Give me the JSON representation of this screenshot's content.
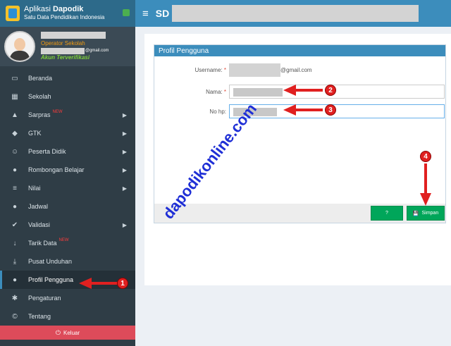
{
  "app": {
    "title_prefix": "Aplikasi",
    "title_bold": "Dapodik",
    "subtitle": "Satu Data Pendidikan Indonesia",
    "school_prefix": "SD"
  },
  "user": {
    "role": "Operator Sekolah",
    "email_suffix": "@gmail.com",
    "status": "Akun Terverifikasi"
  },
  "sidebar": {
    "items": [
      {
        "label": "Beranda",
        "icon": "monitor-icon",
        "glyph": "▭",
        "caret": ""
      },
      {
        "label": "Sekolah",
        "icon": "building-icon",
        "glyph": "▦",
        "caret": ""
      },
      {
        "label": "Sarpras",
        "icon": "road-icon",
        "glyph": "▲",
        "new": "NEW",
        "caret": "▶"
      },
      {
        "label": "GTK",
        "icon": "graduation-cap-icon",
        "glyph": "◆",
        "caret": "▶"
      },
      {
        "label": "Peserta Didik",
        "icon": "smile-icon",
        "glyph": "☺",
        "caret": "▶"
      },
      {
        "label": "Rombongan Belajar",
        "icon": "users-icon",
        "glyph": "●",
        "caret": "▶"
      },
      {
        "label": "Nilai",
        "icon": "list-icon",
        "glyph": "≡",
        "caret": "▶"
      },
      {
        "label": "Jadwal",
        "icon": "group-icon",
        "glyph": "●",
        "caret": ""
      },
      {
        "label": "Validasi",
        "icon": "check-icon",
        "glyph": "✔",
        "caret": "▶"
      },
      {
        "label": "Tarik Data",
        "icon": "arrow-down-icon",
        "glyph": "↓",
        "new": "NEW",
        "caret": ""
      },
      {
        "label": "Pusat Unduhan",
        "icon": "download-icon",
        "glyph": "⤓",
        "caret": ""
      },
      {
        "label": "Profil Pengguna",
        "icon": "user-icon",
        "glyph": "●",
        "caret": ""
      },
      {
        "label": "Pengaturan",
        "icon": "gear-icon",
        "glyph": "✱",
        "caret": ""
      },
      {
        "label": "Tentang",
        "icon": "copyright-icon",
        "glyph": "©",
        "caret": ""
      }
    ],
    "logout_label": "Keluar",
    "logout_icon": "⏻"
  },
  "profile": {
    "panel_title": "Profil Pengguna",
    "username_label": "Username:",
    "required_mark": "*",
    "username_suffix": "@gmail.com",
    "name_label": "Nama:",
    "phone_label": "No hp:",
    "help_label": "?",
    "save_label": "Simpan",
    "save_icon": "💾"
  },
  "annotations": {
    "badge_1": "1",
    "badge_2": "2",
    "badge_3": "3",
    "badge_4": "4",
    "watermark": "dapodikonline.com",
    "arrow_color": "#e02020"
  }
}
